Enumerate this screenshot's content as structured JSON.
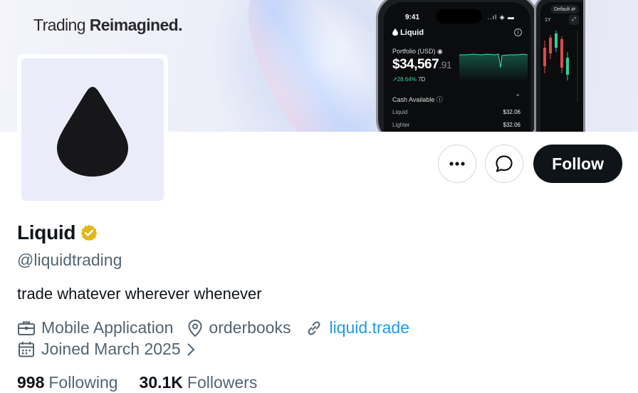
{
  "banner": {
    "tagline_regular": "Trading",
    "tagline_bold": "Reimagined.",
    "phone": {
      "time": "9:41",
      "signal": "..ıl ◈ ▬",
      "brand": "Liquid",
      "portfolio_label": "Portfolio (USD) ◉",
      "value_main": "$34,567",
      "value_cents": ".91",
      "change": "↗28.64%",
      "change_period": "7D",
      "cash_label": "Cash Available ⓘ",
      "cash_rows": [
        {
          "name": "Liquid",
          "value": "$32.06"
        },
        {
          "name": "Lighter",
          "value": "$32.06"
        }
      ]
    },
    "phone2": {
      "pill": "Default ⇄",
      "tab": "1Y",
      "expand": "⤢"
    }
  },
  "actions": {
    "more_label": "More",
    "message_label": "Message",
    "follow_label": "Follow"
  },
  "profile": {
    "name": "Liquid",
    "handle": "@liquidtrading",
    "bio": "trade whatever wherever whenever",
    "category": "Mobile Application",
    "location": "orderbooks",
    "website": "liquid.trade",
    "joined": "Joined March 2025",
    "following_count": "998",
    "following_label": "Following",
    "followers_count": "30.1K",
    "followers_label": "Followers"
  },
  "colors": {
    "accent_link": "#1d9bf0",
    "verified_gold": "#e2b719",
    "text_primary": "#0f1419",
    "text_secondary": "#536471",
    "follow_bg": "#0f1419"
  }
}
